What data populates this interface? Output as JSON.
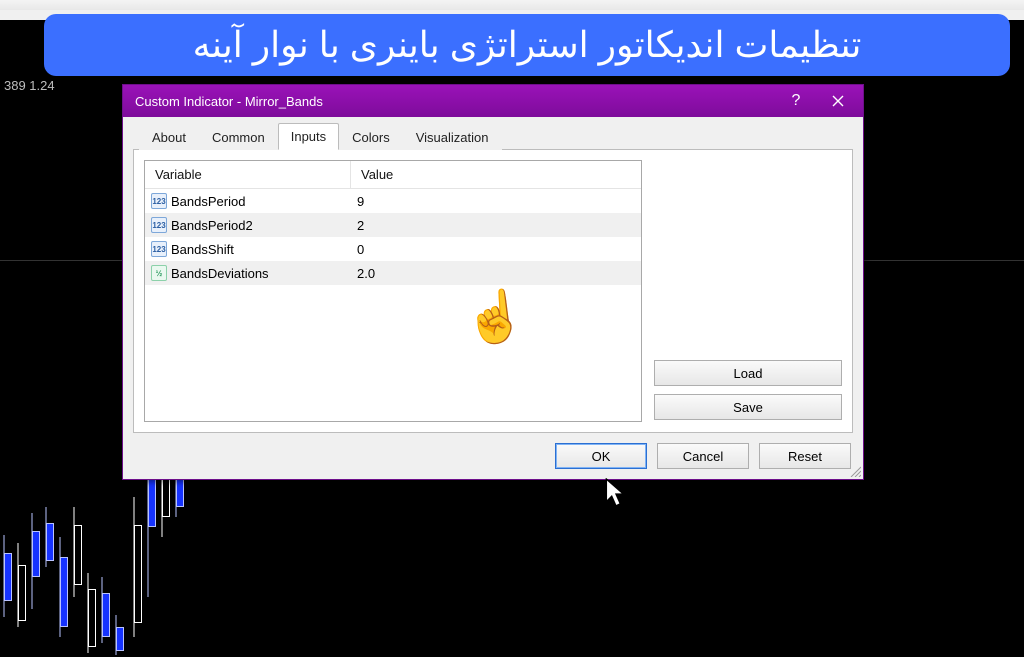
{
  "banner_text": "تنظیمات اندیکاتور استراتژی باینری با نوار آینه",
  "status_text": "389 1.24",
  "dialog": {
    "title": "Custom Indicator - Mirror_Bands",
    "tabs": [
      "About",
      "Common",
      "Inputs",
      "Colors",
      "Visualization"
    ],
    "active_tab": "Inputs",
    "columns": {
      "variable": "Variable",
      "value": "Value"
    },
    "rows": [
      {
        "name": "BandsPeriod",
        "value": "9",
        "type": "int"
      },
      {
        "name": "BandsPeriod2",
        "value": "2",
        "type": "int"
      },
      {
        "name": "BandsShift",
        "value": "0",
        "type": "int"
      },
      {
        "name": "BandsDeviations",
        "value": "2.0",
        "type": "dbl"
      }
    ],
    "buttons": {
      "load": "Load",
      "save": "Save",
      "ok": "OK",
      "cancel": "Cancel",
      "reset": "Reset"
    }
  }
}
